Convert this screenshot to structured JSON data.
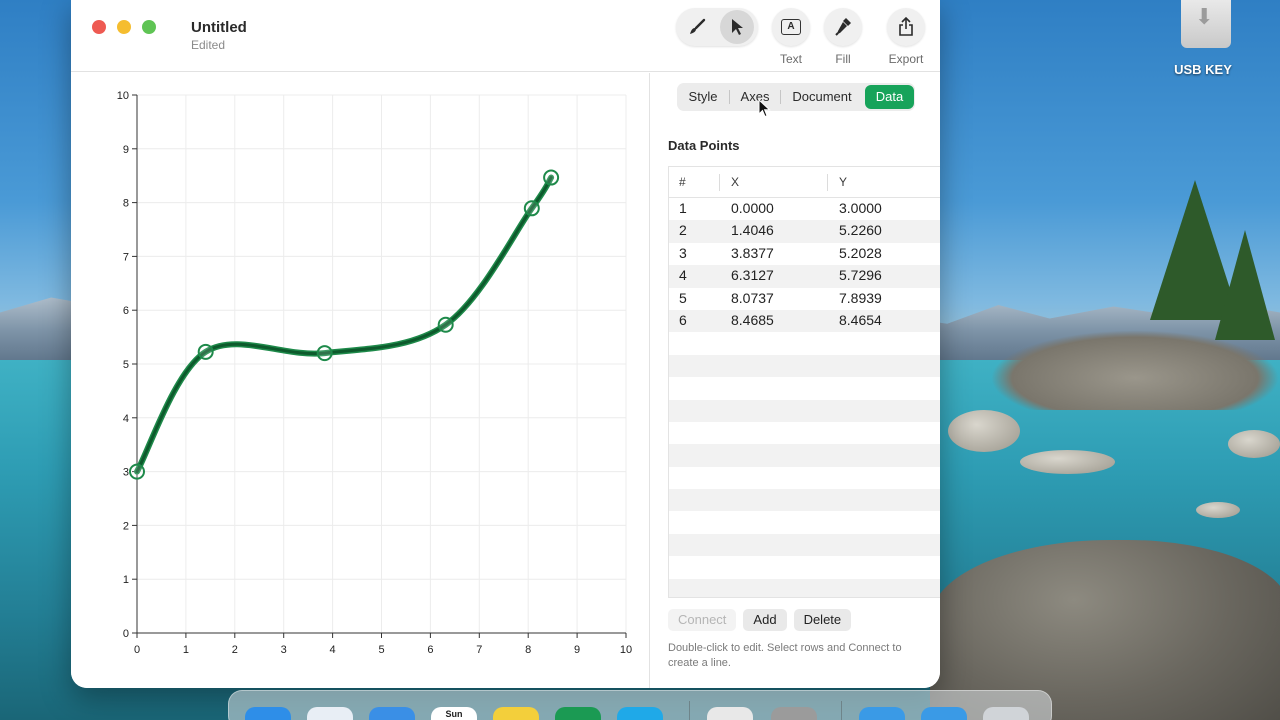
{
  "desktop": {
    "usb_label": "USB KEY"
  },
  "window": {
    "title": "Untitled",
    "subtitle": "Edited",
    "toolbar": {
      "text_label": "Text",
      "fill_label": "Fill",
      "export_label": "Export"
    }
  },
  "panel": {
    "tabs": [
      "Style",
      "Axes",
      "Document",
      "Data"
    ],
    "active_tab": "Data",
    "section_title": "Data Points",
    "table": {
      "headers": [
        "#",
        "X",
        "Y"
      ],
      "rows": [
        [
          "1",
          "0.0000",
          "3.0000"
        ],
        [
          "2",
          "1.4046",
          "5.2260"
        ],
        [
          "3",
          "3.8377",
          "5.2028"
        ],
        [
          "4",
          "6.3127",
          "5.7296"
        ],
        [
          "5",
          "8.0737",
          "7.8939"
        ],
        [
          "6",
          "8.4685",
          "8.4654"
        ]
      ]
    },
    "buttons": {
      "connect": "Connect",
      "add": "Add",
      "delete": "Delete"
    },
    "hint": "Double-click to edit. Select rows and Connect to create a line."
  },
  "dock": {
    "calendar_day": "Sun"
  },
  "colors": {
    "accent": "#17a35a",
    "curve": "#0d5a2c",
    "curve_edge": "#1e8a4a"
  },
  "chart_data": {
    "type": "line",
    "x": [
      0.0,
      1.4046,
      3.8377,
      6.3127,
      8.0737,
      8.4685
    ],
    "y": [
      3.0,
      5.226,
      5.2028,
      5.7296,
      7.8939,
      8.4654
    ],
    "xlim": [
      0,
      10
    ],
    "ylim": [
      0,
      10
    ],
    "xticks": [
      0,
      1,
      2,
      3,
      4,
      5,
      6,
      7,
      8,
      9,
      10
    ],
    "yticks": [
      0,
      1,
      2,
      3,
      4,
      5,
      6,
      7,
      8,
      9,
      10
    ],
    "grid": true,
    "smooth": true,
    "markers": "hollow-circle"
  }
}
